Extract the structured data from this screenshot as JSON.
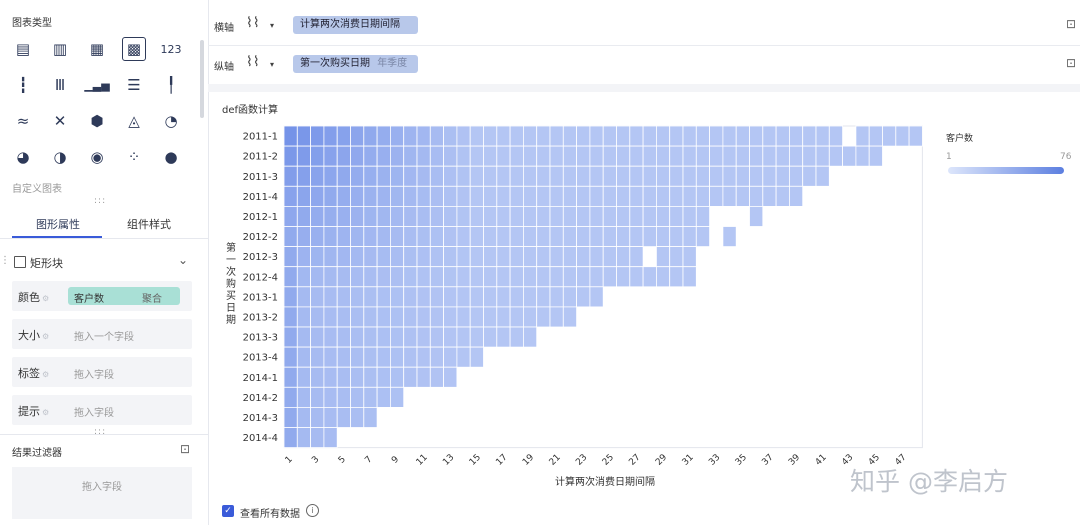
{
  "left_panel": {
    "chart_type_title": "图表类型",
    "chart_icons": [
      {
        "icon": "table-icon",
        "glyph": "▤"
      },
      {
        "icon": "cross-table-icon",
        "glyph": "▥"
      },
      {
        "icon": "detail-table-icon",
        "glyph": "▦"
      },
      {
        "icon": "heatmap-icon",
        "glyph": "▩"
      },
      {
        "icon": "number-icon",
        "glyph": "123"
      },
      {
        "icon": "grouped-bar-icon",
        "glyph": "┇"
      },
      {
        "icon": "stacked-bar-icon",
        "glyph": "Ⅲ"
      },
      {
        "icon": "column-icon",
        "glyph": "▁▃▅"
      },
      {
        "icon": "horizontal-bar-icon",
        "glyph": "☰"
      },
      {
        "icon": "waterfall-icon",
        "glyph": "╿"
      },
      {
        "icon": "line-icon",
        "glyph": "≈"
      },
      {
        "icon": "radar-icon",
        "glyph": "✕"
      },
      {
        "icon": "polygon-icon",
        "glyph": "⬢"
      },
      {
        "icon": "area-icon",
        "glyph": "◬"
      },
      {
        "icon": "gauge-icon",
        "glyph": "◔"
      },
      {
        "icon": "pie-icon",
        "glyph": "◕"
      },
      {
        "icon": "rose-pie-icon",
        "glyph": "◑"
      },
      {
        "icon": "ring-icon",
        "glyph": "◉"
      },
      {
        "icon": "scatter-icon",
        "glyph": "⁘"
      },
      {
        "icon": "bubble-icon",
        "glyph": "●"
      }
    ],
    "custom_chart_label": "自定义图表",
    "tabs": [
      {
        "label": "图形属性"
      },
      {
        "label": "组件样式"
      }
    ],
    "mark_type": "矩形块",
    "props": [
      {
        "label": "颜色",
        "value": "客户数",
        "agg": "聚合"
      },
      {
        "label": "大小",
        "placeholder": "拖入一个字段"
      },
      {
        "label": "标签",
        "placeholder": "拖入字段"
      },
      {
        "label": "提示",
        "placeholder": "拖入字段"
      }
    ],
    "result_filter_title": "结果过滤器",
    "result_filter_placeholder": "拖入字段"
  },
  "axes": {
    "x_label": "横轴",
    "x_field": "计算两次消费日期间隔",
    "y_label": "纵轴",
    "y_field": "第一次购买日期",
    "y_field_sub": "年季度"
  },
  "chart_title": "def函数计算",
  "show_all_label": "查看所有数据",
  "legend": {
    "title": "客户数",
    "min": "1",
    "max": "76",
    "color_start": "#dde6fb",
    "color_end": "#5c7fe0"
  },
  "watermark": "知乎 @李启方",
  "chart_data": {
    "type": "heatmap",
    "title": "",
    "xlabel": "计算两次消费日期间隔",
    "ylabel": "第一次购买日期",
    "x_tick_labels": [
      "1",
      "3",
      "5",
      "7",
      "9",
      "11",
      "13",
      "15",
      "17",
      "19",
      "21",
      "23",
      "25",
      "27",
      "29",
      "31",
      "33",
      "35",
      "37",
      "39",
      "41",
      "43",
      "45",
      "47"
    ],
    "x_range": [
      1,
      48
    ],
    "rows": [
      "2011-1",
      "2011-2",
      "2011-3",
      "2011-4",
      "2012-1",
      "2012-2",
      "2012-3",
      "2012-4",
      "2013-1",
      "2013-2",
      "2013-3",
      "2013-4",
      "2014-1",
      "2014-2",
      "2014-3",
      "2014-4"
    ],
    "row_lengths": [
      48,
      45,
      41,
      39,
      32,
      34,
      29,
      31,
      24,
      22,
      19,
      15,
      13,
      9,
      7,
      4
    ],
    "missing_cells": [
      {
        "row": "2011-1",
        "x": 43
      },
      {
        "row": "2012-1",
        "x": 34
      },
      {
        "row": "2012-1",
        "x": 35
      },
      {
        "row": "2012-2",
        "x": 33
      },
      {
        "row": "2012-3",
        "x": 28
      }
    ],
    "extra_cells": [
      {
        "row": "2012-1",
        "x": 35
      },
      {
        "row": "2012-1",
        "x": 36
      },
      {
        "row": "2012-3",
        "x": 30
      },
      {
        "row": "2012-3",
        "x": 31
      }
    ],
    "color_field": "客户数",
    "color_range": [
      1,
      76
    ]
  }
}
